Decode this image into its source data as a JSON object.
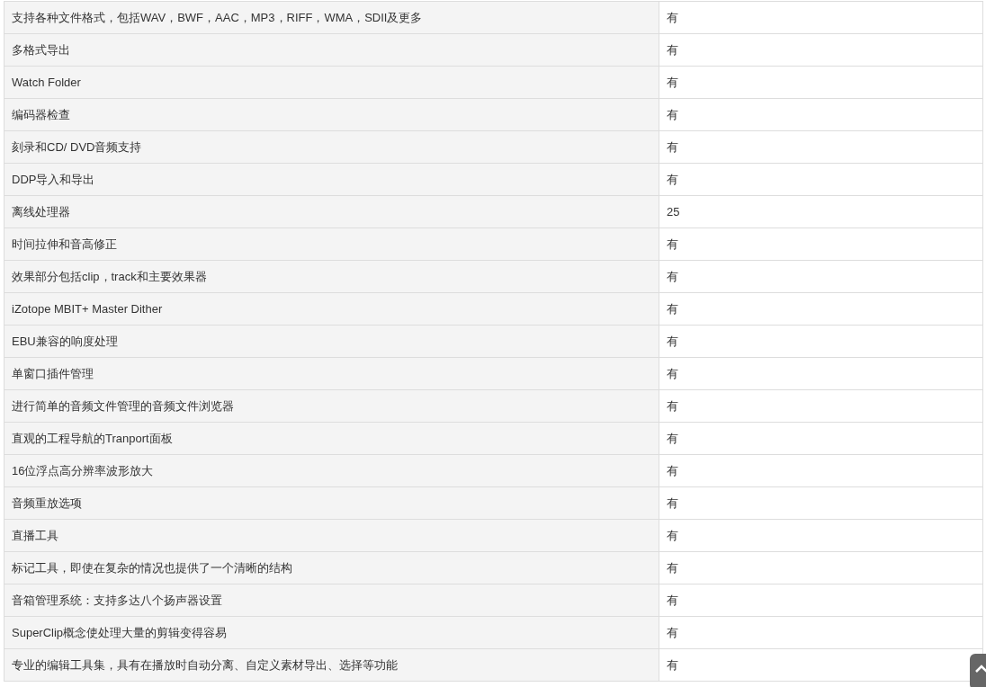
{
  "table": {
    "rows": [
      {
        "feature": "支持各种文件格式，包括WAV，BWF，AAC，MP3，RIFF，WMA，SDII及更多",
        "value": "有"
      },
      {
        "feature": "多格式导出",
        "value": "有"
      },
      {
        "feature": "Watch Folder",
        "value": "有"
      },
      {
        "feature": "编码器检查",
        "value": "有"
      },
      {
        "feature": "刻录和CD/ DVD音频支持",
        "value": "有"
      },
      {
        "feature": "DDP导入和导出",
        "value": "有"
      },
      {
        "feature": "离线处理器",
        "value": "25"
      },
      {
        "feature": "时间拉伸和音高修正",
        "value": "有"
      },
      {
        "feature": "效果部分包括clip，track和主要效果器",
        "value": "有"
      },
      {
        "feature": "iZotope MBIT+ Master Dither",
        "value": "有"
      },
      {
        "feature": "EBU兼容的响度处理",
        "value": "有"
      },
      {
        "feature": "单窗口插件管理",
        "value": "有"
      },
      {
        "feature": "进行简单的音频文件管理的音频文件浏览器",
        "value": "有"
      },
      {
        "feature": "直观的工程导航的Tranport面板",
        "value": "有"
      },
      {
        "feature": "16位浮点高分辨率波形放大",
        "value": "有"
      },
      {
        "feature": "音频重放选项",
        "value": "有"
      },
      {
        "feature": "直播工具",
        "value": "有"
      },
      {
        "feature": "标记工具，即使在复杂的情况也提供了一个清晰的结构",
        "value": "有"
      },
      {
        "feature": "音箱管理系统：支持多达八个扬声器设置",
        "value": "有"
      },
      {
        "feature": "SuperClip概念使处理大量的剪辑变得容易",
        "value": "有"
      },
      {
        "feature": "专业的编辑工具集，具有在播放时自动分离、自定义素材导出、选择等功能",
        "value": "有"
      }
    ]
  }
}
